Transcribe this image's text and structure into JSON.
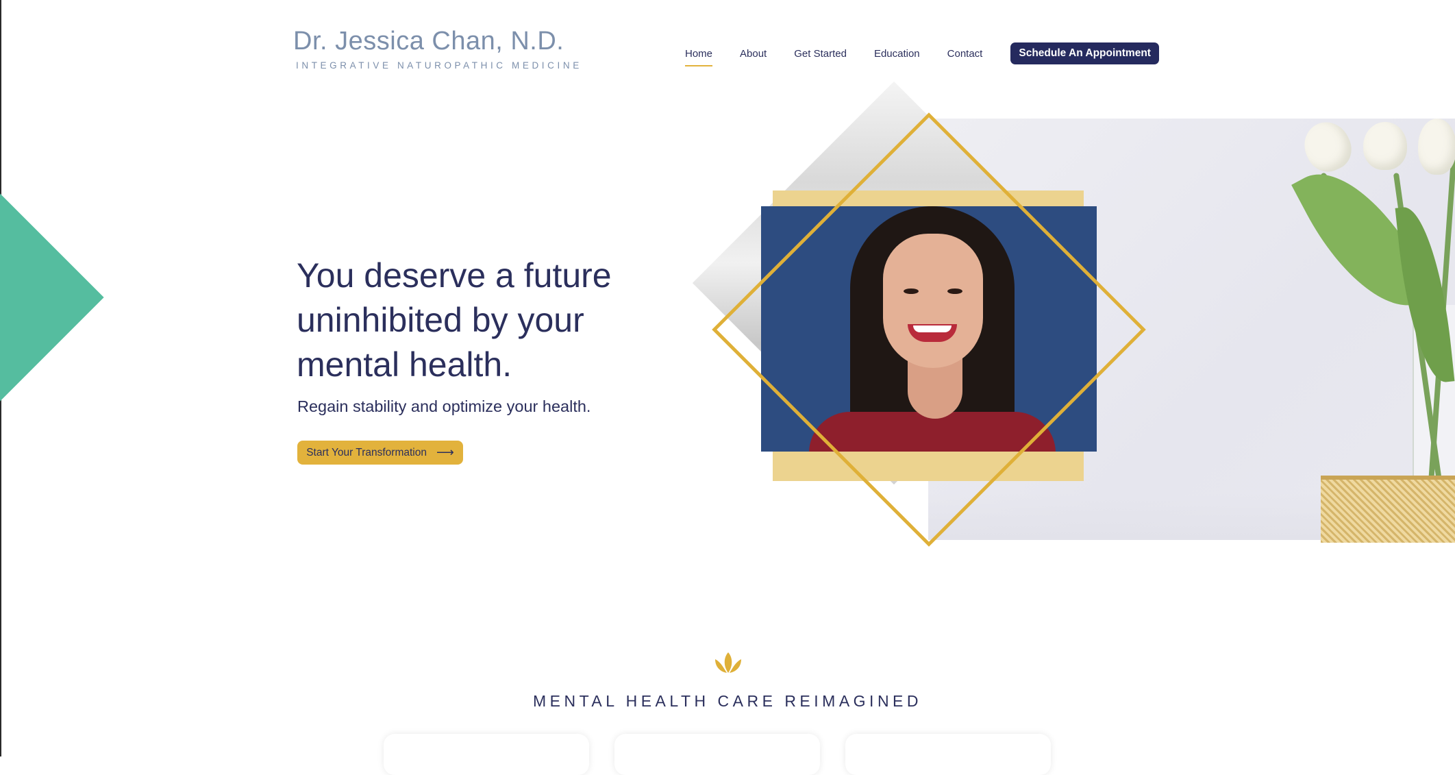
{
  "header": {
    "logo_name": "Dr. Jessica Chan, N.D.",
    "logo_tagline": "INTEGRATIVE NATUROPATHIC MEDICINE",
    "nav": [
      {
        "label": "Home",
        "active": true
      },
      {
        "label": "About"
      },
      {
        "label": "Get Started"
      },
      {
        "label": "Education"
      },
      {
        "label": "Contact"
      }
    ],
    "cta_label": "Schedule An Appointment"
  },
  "hero": {
    "headline": "You deserve a future uninhibited by your mental health.",
    "subhead": "Regain stability and optimize your health.",
    "cta_label": "Start Your Transformation",
    "cta_icon": "arrow-right-icon"
  },
  "section": {
    "icon": "lotus-icon",
    "title": "MENTAL HEALTH CARE REIMAGINED"
  },
  "colors": {
    "navy": "#252a5e",
    "gold": "#e2b23c",
    "green": "#55bd9f",
    "logo_blue": "#7c8fab"
  }
}
